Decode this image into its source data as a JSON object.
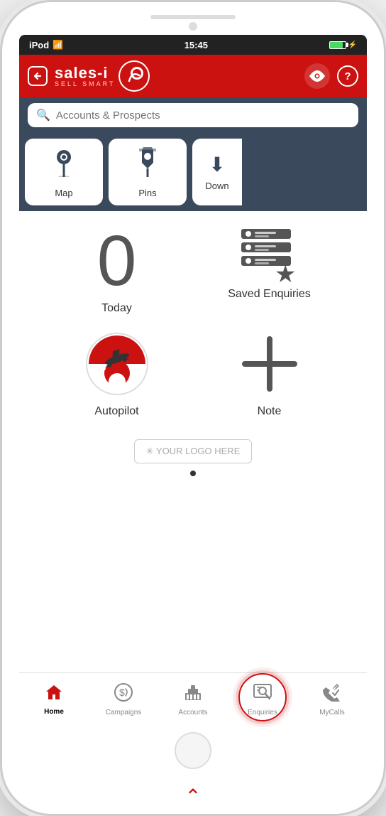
{
  "device": {
    "status_bar": {
      "carrier": "iPod",
      "time": "15:45",
      "battery_percent": 85
    }
  },
  "header": {
    "back_label": "←",
    "logo_main": "sales-i",
    "logo_sub": "SELL SMART",
    "eye_label": "👁",
    "help_label": "?"
  },
  "search": {
    "placeholder": "Accounts & Prospects"
  },
  "toolbar": {
    "map_label": "Map",
    "pins_label": "Pins",
    "down_label": "Down"
  },
  "main": {
    "today_count": "0",
    "today_label": "Today",
    "saved_enquiries_label": "Saved Enquiries",
    "autopilot_label": "Autopilot",
    "note_label": "Note",
    "logo_placeholder": "✳ YOUR LOGO HERE"
  },
  "tabs": [
    {
      "id": "home",
      "label": "Home",
      "icon": "🏠",
      "active": true
    },
    {
      "id": "campaigns",
      "label": "Campaigns",
      "icon": "💰",
      "active": false
    },
    {
      "id": "accounts",
      "label": "Accounts",
      "icon": "🏛",
      "active": false
    },
    {
      "id": "enquiries",
      "label": "Enquiries",
      "icon": "🔍",
      "active": false,
      "highlight": true
    },
    {
      "id": "mycalls",
      "label": "MyCalls",
      "icon": "✓",
      "active": false
    }
  ],
  "colors": {
    "brand_red": "#cc1111",
    "dark_navy": "#3a4a5c",
    "text_dark": "#333333",
    "text_gray": "#888888"
  }
}
